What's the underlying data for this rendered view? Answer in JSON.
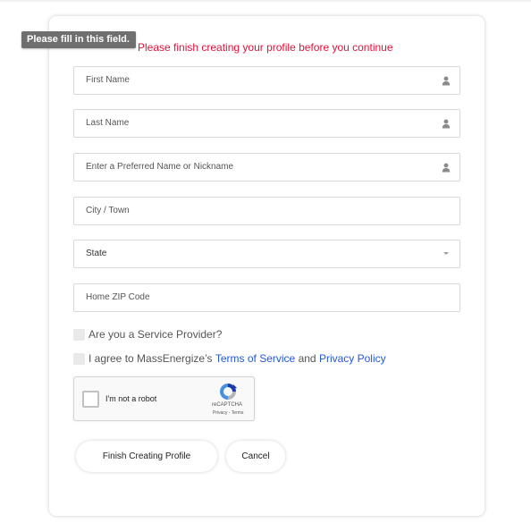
{
  "validation_tooltip": "Please fill in this field.",
  "notice": "Please finish creating your profile before you continue",
  "form": {
    "first_name": {
      "placeholder": "First Name",
      "icon": "person-icon"
    },
    "last_name": {
      "placeholder": "Last Name",
      "icon": "person-icon"
    },
    "preferred_name": {
      "placeholder": "Enter a Preferred Name or Nickname",
      "icon": "person-icon"
    },
    "city": {
      "placeholder": "City / Town"
    },
    "state": {
      "selected": "State",
      "icon": "chevron-down-icon"
    },
    "zip": {
      "placeholder": "Home ZIP Code"
    }
  },
  "checkboxes": {
    "service_provider": "Are you a Service Provider?",
    "agree_prefix": "I agree to MassEnergize’s",
    "terms_link": "Terms of Service",
    "agree_and": "and",
    "privacy_link": "Privacy Policy"
  },
  "recaptcha": {
    "label": "I'm not a robot",
    "brand": "reCAPTCHA",
    "privacy": "Privacy",
    "sep": "-",
    "terms": "Terms"
  },
  "buttons": {
    "finish": "Finish Creating Profile",
    "cancel": "Cancel"
  },
  "colors": {
    "notice": "#e0113a",
    "link": "#2458d6",
    "tooltip_bg": "#6f6f6f"
  }
}
